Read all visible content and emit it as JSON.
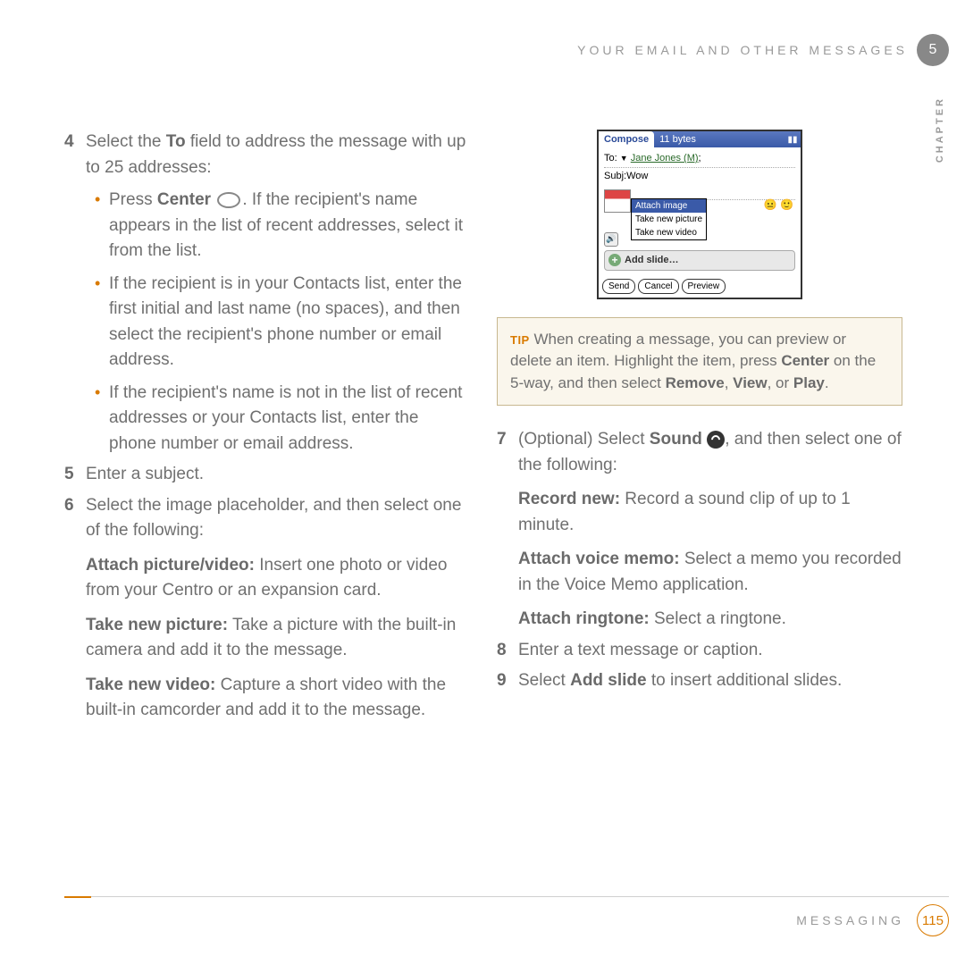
{
  "header": {
    "section_title": "YOUR EMAIL AND OTHER MESSAGES",
    "chapter_num": "5",
    "chapter_label": "CHAPTER"
  },
  "left": {
    "step4_num": "4",
    "step4_text_a": "Select the ",
    "step4_to": "To",
    "step4_text_b": " field to address the message with up to 25 addresses:",
    "b1_a": "Press ",
    "b1_center": "Center",
    "b1_b": ". If the recipient's name appears in the list of recent addresses, select it from the list.",
    "b2": "If the recipient is in your Contacts list, enter the first initial and last name (no spaces), and then select the recipient's phone number or email address.",
    "b3": "If the recipient's name is not in the list of recent addresses or your Contacts list, enter the phone number or email address.",
    "step5_num": "5",
    "step5_text": "Enter a subject.",
    "step6_num": "6",
    "step6_text": "Select the image placeholder, and then select one of the following:",
    "opt1_label": "Attach picture/video:",
    "opt1_text": " Insert one photo or video from your Centro or an expansion card.",
    "opt2_label": "Take new picture:",
    "opt2_text": " Take a picture with the built-in camera and add it to the message.",
    "opt3_label": "Take new video:",
    "opt3_text": " Capture a short video with the built-in camcorder and add it to the message."
  },
  "screenshot": {
    "tab": "Compose",
    "bytes": "11 bytes",
    "to_prefix": "To:",
    "to_contact": "Jane Jones (M)",
    "to_suffix": ";",
    "subj_prefix": "Subj:",
    "subj_value": "Wow",
    "menu1": "Attach image",
    "menu2": "Take new picture",
    "menu3": "Take new video",
    "addslide": "Add slide…",
    "btn_send": "Send",
    "btn_cancel": "Cancel",
    "btn_preview": "Preview"
  },
  "tip": {
    "label": "TIP",
    "text_a": " When creating a message, you can preview or delete an item. Highlight the item, press ",
    "center": "Center",
    "text_b": " on the 5-way, and then select ",
    "remove": "Remove",
    "comma1": ", ",
    "view": "View",
    "or": ", or ",
    "play": "Play",
    "period": "."
  },
  "right": {
    "step7_num": "7",
    "step7_a": "(Optional)  Select ",
    "step7_sound": "Sound",
    "step7_b": ", and then select one of the following:",
    "r1_label": "Record new:",
    "r1_text": " Record a sound clip of up to 1 minute.",
    "r2_label": "Attach voice memo:",
    "r2_text": " Select a memo you recorded in the Voice Memo application.",
    "r3_label": "Attach ringtone:",
    "r3_text": " Select a ringtone.",
    "step8_num": "8",
    "step8_text": "Enter a text message or caption.",
    "step9_num": "9",
    "step9_a": "Select ",
    "step9_add": "Add slide",
    "step9_b": " to insert additional slides."
  },
  "footer": {
    "label": "MESSAGING",
    "page": "115"
  }
}
